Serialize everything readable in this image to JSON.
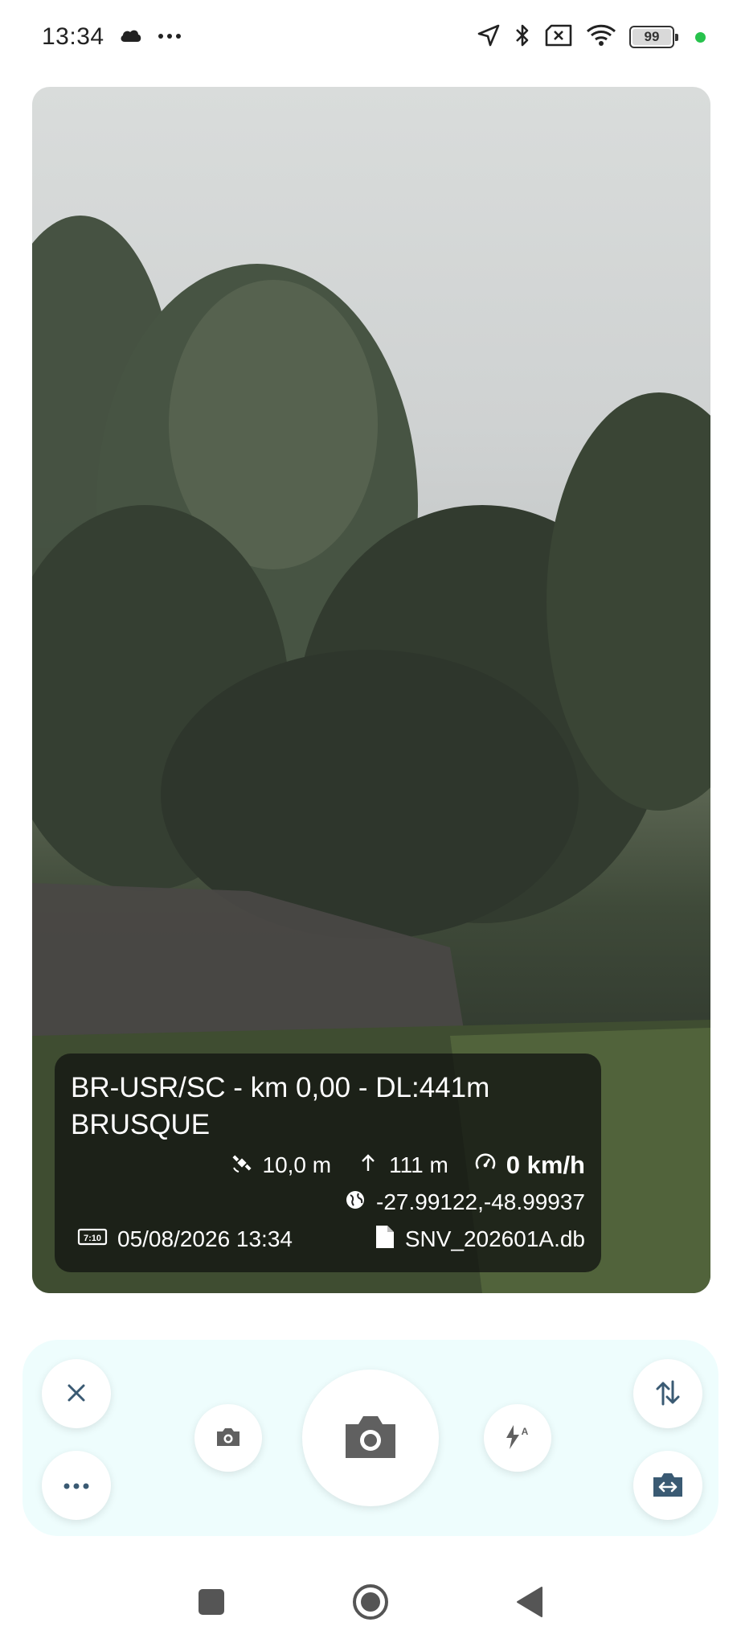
{
  "status_bar": {
    "time": "13:34",
    "battery_level": "99",
    "icons": [
      "cloud-icon",
      "more-dots-icon",
      "location-arrow-icon",
      "bluetooth-icon",
      "no-sim-icon",
      "wifi-icon",
      "battery-icon",
      "recording-dot-icon"
    ]
  },
  "overlay": {
    "road_line": "BR-USR/SC - km 0,00 - DL:441m",
    "city": "BRUSQUE",
    "accuracy": "10,0 m",
    "altitude": "111 m",
    "speed": "0 km/h",
    "coordinates": "-27.99122,-48.99937",
    "datetime": "05/08/2026 13:34",
    "database": "SNV_202601A.db"
  },
  "controls": {
    "close_icon": "close-icon",
    "more_icon": "more-horizontal-icon",
    "photo_small_icon": "camera-small-icon",
    "shutter_icon": "camera-icon",
    "flash_icon": "flash-auto-icon",
    "swap_icon": "swap-vertical-icon",
    "switch_camera_icon": "switch-camera-icon"
  },
  "colors": {
    "panel_bg": "#eefdfd",
    "accent_blue": "#3a5a73",
    "icon_gray": "#606060",
    "status_green": "#27c24c"
  },
  "nav_bar": {
    "icons": [
      "square-recent-icon",
      "circle-home-icon",
      "triangle-back-icon"
    ]
  }
}
